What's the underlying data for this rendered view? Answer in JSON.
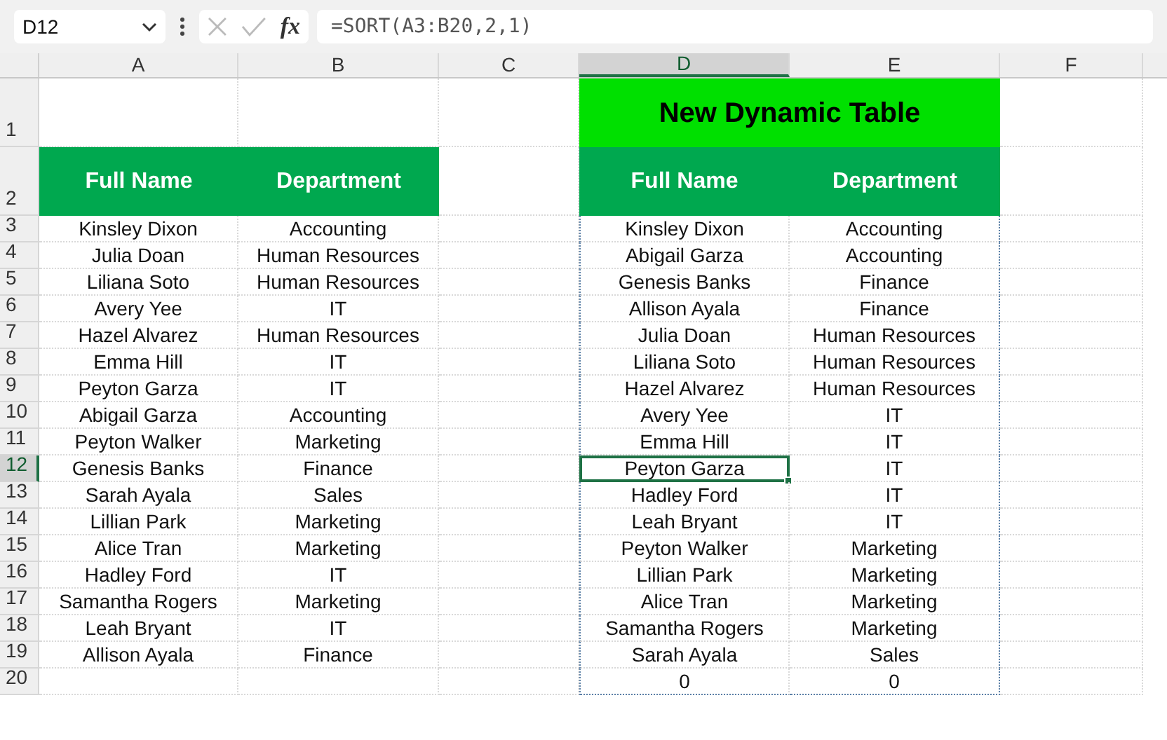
{
  "name_box": "D12",
  "fx_label": "fx",
  "formula": "=SORT(A3:B20,2,1)",
  "columns": [
    {
      "label": "A",
      "selected": false
    },
    {
      "label": "B",
      "selected": false
    },
    {
      "label": "C",
      "selected": false
    },
    {
      "label": "D",
      "selected": true
    },
    {
      "label": "E",
      "selected": false
    },
    {
      "label": "F",
      "selected": false
    }
  ],
  "row_numbers": [
    {
      "label": "1",
      "selected": false
    },
    {
      "label": "2",
      "selected": false
    },
    {
      "label": "3",
      "selected": false
    },
    {
      "label": "4",
      "selected": false
    },
    {
      "label": "5",
      "selected": false
    },
    {
      "label": "6",
      "selected": false
    },
    {
      "label": "7",
      "selected": false
    },
    {
      "label": "8",
      "selected": false
    },
    {
      "label": "9",
      "selected": false
    },
    {
      "label": "10",
      "selected": false
    },
    {
      "label": "11",
      "selected": false
    },
    {
      "label": "12",
      "selected": true
    },
    {
      "label": "13",
      "selected": false
    },
    {
      "label": "14",
      "selected": false
    },
    {
      "label": "15",
      "selected": false
    },
    {
      "label": "16",
      "selected": false
    },
    {
      "label": "17",
      "selected": false
    },
    {
      "label": "18",
      "selected": false
    },
    {
      "label": "19",
      "selected": false
    },
    {
      "label": "20",
      "selected": false
    }
  ],
  "source_table": {
    "headers": [
      "Full Name",
      "Department"
    ],
    "rows": [
      [
        "Kinsley Dixon",
        "Accounting"
      ],
      [
        "Julia Doan",
        "Human Resources"
      ],
      [
        "Liliana Soto",
        "Human Resources"
      ],
      [
        "Avery Yee",
        "IT"
      ],
      [
        "Hazel Alvarez",
        "Human Resources"
      ],
      [
        "Emma Hill",
        "IT"
      ],
      [
        "Peyton Garza",
        "IT"
      ],
      [
        "Abigail Garza",
        "Accounting"
      ],
      [
        "Peyton Walker",
        "Marketing"
      ],
      [
        "Genesis Banks",
        "Finance"
      ],
      [
        "Sarah Ayala",
        "Sales"
      ],
      [
        "Lillian Park",
        "Marketing"
      ],
      [
        "Alice Tran",
        "Marketing"
      ],
      [
        "Hadley Ford",
        "IT"
      ],
      [
        "Samantha Rogers",
        "Marketing"
      ],
      [
        "Leah Bryant",
        "IT"
      ],
      [
        "Allison Ayala",
        "Finance"
      ]
    ]
  },
  "dynamic_table": {
    "title": "New Dynamic Table",
    "headers": [
      "Full Name",
      "Department"
    ],
    "rows": [
      {
        "full_name": "Kinsley Dixon",
        "department": "Accounting",
        "selected": false
      },
      {
        "full_name": "Abigail Garza",
        "department": "Accounting",
        "selected": false
      },
      {
        "full_name": "Genesis Banks",
        "department": "Finance",
        "selected": false
      },
      {
        "full_name": "Allison Ayala",
        "department": "Finance",
        "selected": false
      },
      {
        "full_name": "Julia Doan",
        "department": "Human Resources",
        "selected": false
      },
      {
        "full_name": "Liliana Soto",
        "department": "Human Resources",
        "selected": false
      },
      {
        "full_name": "Hazel Alvarez",
        "department": "Human Resources",
        "selected": false
      },
      {
        "full_name": "Avery Yee",
        "department": "IT",
        "selected": false
      },
      {
        "full_name": "Emma Hill",
        "department": "IT",
        "selected": false
      },
      {
        "full_name": "Peyton Garza",
        "department": "IT",
        "selected": true
      },
      {
        "full_name": "Hadley Ford",
        "department": "IT",
        "selected": false
      },
      {
        "full_name": "Leah Bryant",
        "department": "IT",
        "selected": false
      },
      {
        "full_name": "Peyton Walker",
        "department": "Marketing",
        "selected": false
      },
      {
        "full_name": "Lillian Park",
        "department": "Marketing",
        "selected": false
      },
      {
        "full_name": "Alice Tran",
        "department": "Marketing",
        "selected": false
      },
      {
        "full_name": "Samantha Rogers",
        "department": "Marketing",
        "selected": false
      },
      {
        "full_name": "Sarah Ayala",
        "department": "Sales",
        "selected": false
      },
      {
        "full_name": "0",
        "department": "0",
        "selected": false
      }
    ]
  }
}
